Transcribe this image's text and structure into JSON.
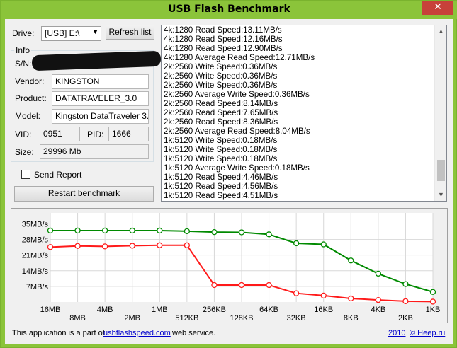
{
  "window": {
    "title": "USB Flash Benchmark",
    "close_glyph": "✕"
  },
  "drive": {
    "label": "Drive:",
    "selected": "[USB] E:\\",
    "refresh_label": "Refresh list"
  },
  "info": {
    "group_title": "Info",
    "sn_label": "S/N:",
    "vendor_label": "Vendor:",
    "vendor": "KINGSTON",
    "product_label": "Product:",
    "product": "DATATRAVELER_3.0",
    "model_label": "Model:",
    "model": "Kingston DataTraveler 3.0",
    "vid_label": "VID:",
    "vid": "0951",
    "pid_label": "PID:",
    "pid": "1666",
    "size_label": "Size:",
    "size": "29996 Mb"
  },
  "send_report_label": "Send Report",
  "restart_label": "Restart benchmark",
  "log": [
    "4k:1280 Read Speed:13.11MB/s",
    "4k:1280 Read Speed:12.16MB/s",
    "4k:1280 Read Speed:12.90MB/s",
    "4k:1280 Average Read Speed:12.71MB/s",
    "2k:2560 Write Speed:0.36MB/s",
    "2k:2560 Write Speed:0.36MB/s",
    "2k:2560 Write Speed:0.36MB/s",
    "2k:2560 Average Write Speed:0.36MB/s",
    "2k:2560 Read Speed:8.14MB/s",
    "2k:2560 Read Speed:7.65MB/s",
    "2k:2560 Read Speed:8.36MB/s",
    "2k:2560 Average Read Speed:8.04MB/s",
    "1k:5120 Write Speed:0.18MB/s",
    "1k:5120 Write Speed:0.18MB/s",
    "1k:5120 Write Speed:0.18MB/s",
    "1k:5120 Average Write Speed:0.18MB/s",
    "1k:5120 Read Speed:4.46MB/s",
    "1k:5120 Read Speed:4.56MB/s",
    "1k:5120 Read Speed:4.51MB/s"
  ],
  "footer": {
    "text_before": "This application is a part of",
    "link": "usbflashspeed.com",
    "text_after": "web service.",
    "year": "2010",
    "copyright": "© Heep.ru"
  },
  "colors": {
    "read": "#008a00",
    "write": "#ff1a1a",
    "title_bar": "#8bc43a"
  },
  "chart_data": {
    "type": "line",
    "categories": [
      "16MB",
      "8MB",
      "4MB",
      "2MB",
      "1MB",
      "512KB",
      "256KB",
      "128KB",
      "64KB",
      "32KB",
      "16KB",
      "8KB",
      "4KB",
      "2KB",
      "1KB"
    ],
    "y_ticks": [
      "35MB/s",
      "28MB/s",
      "21MB/s",
      "14MB/s",
      "7MB/s"
    ],
    "y_tick_values": [
      35,
      28,
      21,
      14,
      7
    ],
    "ylim": [
      0,
      38
    ],
    "grid": true,
    "series": [
      {
        "color": "#008a00",
        "values": [
          32.0,
          32.0,
          32.0,
          32.0,
          32.0,
          31.7,
          31.3,
          31.2,
          30.3,
          26.3,
          25.8,
          18.6,
          12.7,
          8.04,
          4.51
        ]
      },
      {
        "color": "#ff1a1a",
        "values": [
          24.6,
          25.1,
          24.9,
          25.2,
          25.4,
          25.4,
          7.6,
          7.6,
          7.6,
          3.9,
          2.9,
          1.6,
          0.9,
          0.36,
          0.18
        ]
      }
    ]
  }
}
